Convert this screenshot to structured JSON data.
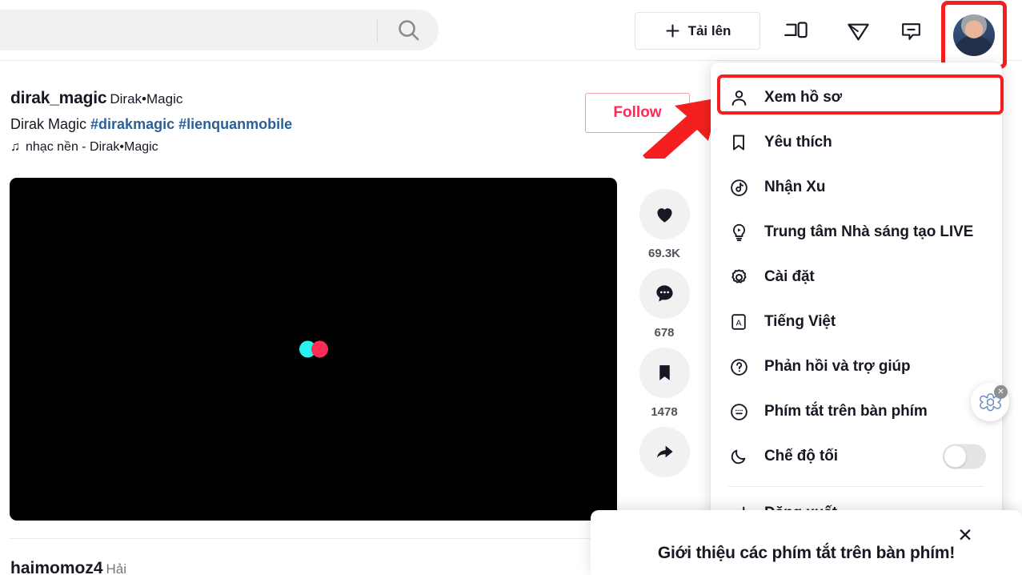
{
  "app": {
    "name": "TikTok",
    "accent_red": "#fe2c55",
    "accent_cyan": "#25f4ee",
    "annotation_red": "#f3201f",
    "link_blue": "#2b5f99"
  },
  "header": {
    "search": {
      "value": "",
      "placeholder": "",
      "icon": "search-icon"
    },
    "upload": {
      "label": "Tải lên",
      "plus_icon": "plus-icon"
    },
    "icons": [
      {
        "name": "get-app-icon",
        "title": ""
      },
      {
        "name": "send-message-icon",
        "title": ""
      },
      {
        "name": "inbox-icon",
        "title": ""
      }
    ],
    "avatar": {
      "name": "profile-avatar",
      "highlighted": true
    }
  },
  "post": {
    "username": "dirak_magic",
    "nickname": "Dirak•Magic",
    "description_plain": "Dirak Magic ",
    "hashtags": [
      "#dirakmagic",
      "#lienquanmobile"
    ],
    "music_icon": "music-note-icon",
    "music": "nhạc nền - Dirak•Magic",
    "follow_label": "Follow",
    "actions": [
      {
        "name": "like-button",
        "icon": "heart-icon",
        "count": "69.3K"
      },
      {
        "name": "comment-button",
        "icon": "comment-icon",
        "count": "678"
      },
      {
        "name": "bookmark-button",
        "icon": "bookmark-icon",
        "count": "1478"
      },
      {
        "name": "share-button",
        "icon": "share-icon",
        "count": ""
      }
    ]
  },
  "menu": {
    "items": [
      {
        "label": "Xem hồ sơ",
        "icon": "person-icon",
        "highlighted": true
      },
      {
        "label": "Yêu thích",
        "icon": "bookmark-outline-icon"
      },
      {
        "label": "Nhận Xu",
        "icon": "coin-note-icon"
      },
      {
        "label": "Trung tâm Nhà sáng tạo LIVE",
        "icon": "live-bulb-icon"
      },
      {
        "label": "Cài đặt",
        "icon": "gear-icon"
      },
      {
        "label": "Tiếng Việt",
        "icon": "language-icon"
      },
      {
        "label": "Phản hồi và trợ giúp",
        "icon": "question-circle-icon"
      },
      {
        "label": "Phím tắt trên bàn phím",
        "icon": "keyboard-icon"
      },
      {
        "label": "Chế độ tối",
        "icon": "moon-icon",
        "toggle": true,
        "toggle_on": false
      }
    ],
    "logout": {
      "label": "Đăng xuất",
      "icon": "logout-icon"
    }
  },
  "toast": {
    "title": "Giới thiệu các phím tắt trên bàn phím!",
    "close_icon": "close-icon"
  },
  "gpt_widget": {
    "icon": "openai-logo-icon",
    "close_icon": "close-icon"
  },
  "next_post": {
    "username": "haimomoz4",
    "nickname": "Hải"
  }
}
